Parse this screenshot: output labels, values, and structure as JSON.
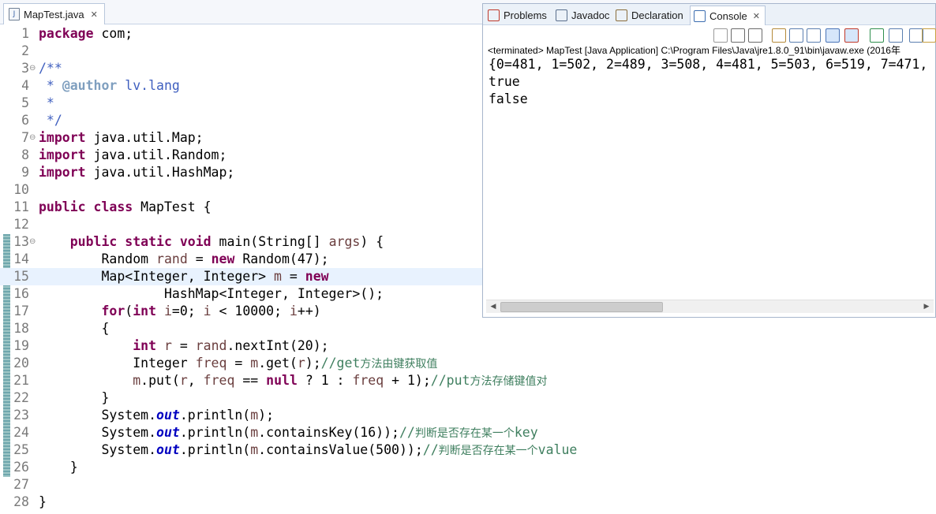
{
  "editor": {
    "tab": {
      "title": "MapTest.java",
      "close": "✕"
    },
    "lines": [
      {
        "n": "1",
        "segs": [
          {
            "t": "package",
            "c": "kw"
          },
          {
            "t": " com;"
          }
        ]
      },
      {
        "n": "2",
        "segs": []
      },
      {
        "n": "3",
        "fold": "⊖",
        "segs": [
          {
            "t": "/**",
            "c": "jd"
          }
        ]
      },
      {
        "n": "4",
        "segs": [
          {
            "t": " * ",
            "c": "jd"
          },
          {
            "t": "@author",
            "c": "tag"
          },
          {
            "t": " lv.lang",
            "c": "jd"
          }
        ]
      },
      {
        "n": "5",
        "segs": [
          {
            "t": " *",
            "c": "jd"
          }
        ]
      },
      {
        "n": "6",
        "segs": [
          {
            "t": " */",
            "c": "jd"
          }
        ]
      },
      {
        "n": "7",
        "fold": "⊖",
        "segs": [
          {
            "t": "import",
            "c": "kw"
          },
          {
            "t": " java.util.Map;"
          }
        ]
      },
      {
        "n": "8",
        "segs": [
          {
            "t": "import",
            "c": "kw"
          },
          {
            "t": " java.util.Random;"
          }
        ]
      },
      {
        "n": "9",
        "segs": [
          {
            "t": "import",
            "c": "kw"
          },
          {
            "t": " java.util.HashMap;"
          }
        ]
      },
      {
        "n": "10",
        "segs": []
      },
      {
        "n": "11",
        "segs": [
          {
            "t": "public",
            "c": "kw"
          },
          {
            "t": " "
          },
          {
            "t": "class",
            "c": "kw"
          },
          {
            "t": " MapTest {"
          }
        ]
      },
      {
        "n": "12",
        "segs": []
      },
      {
        "n": "13",
        "fold": "⊖",
        "segs": [
          {
            "t": "    "
          },
          {
            "t": "public",
            "c": "kw"
          },
          {
            "t": " "
          },
          {
            "t": "static",
            "c": "kw"
          },
          {
            "t": " "
          },
          {
            "t": "void",
            "c": "kw"
          },
          {
            "t": " main(String[] "
          },
          {
            "t": "args",
            "c": "var"
          },
          {
            "t": ") {"
          }
        ]
      },
      {
        "n": "14",
        "segs": [
          {
            "t": "        Random "
          },
          {
            "t": "rand",
            "c": "var"
          },
          {
            "t": " = "
          },
          {
            "t": "new",
            "c": "kw"
          },
          {
            "t": " Random(47);"
          }
        ]
      },
      {
        "n": "15",
        "current": true,
        "segs": [
          {
            "t": "        Map<Integer, Integer> "
          },
          {
            "t": "m",
            "c": "var"
          },
          {
            "t": " = "
          },
          {
            "t": "new",
            "c": "kw"
          }
        ]
      },
      {
        "n": "16",
        "segs": [
          {
            "t": "                HashMap<Integer, Integer>();"
          }
        ]
      },
      {
        "n": "17",
        "segs": [
          {
            "t": "        "
          },
          {
            "t": "for",
            "c": "kw"
          },
          {
            "t": "("
          },
          {
            "t": "int",
            "c": "kw"
          },
          {
            "t": " "
          },
          {
            "t": "i",
            "c": "var"
          },
          {
            "t": "=0; "
          },
          {
            "t": "i",
            "c": "var"
          },
          {
            "t": " < 10000; "
          },
          {
            "t": "i",
            "c": "var"
          },
          {
            "t": "++)"
          }
        ]
      },
      {
        "n": "18",
        "segs": [
          {
            "t": "        {"
          }
        ]
      },
      {
        "n": "19",
        "segs": [
          {
            "t": "            "
          },
          {
            "t": "int",
            "c": "kw"
          },
          {
            "t": " "
          },
          {
            "t": "r",
            "c": "var"
          },
          {
            "t": " = "
          },
          {
            "t": "rand",
            "c": "var"
          },
          {
            "t": ".nextInt(20);"
          }
        ]
      },
      {
        "n": "20",
        "segs": [
          {
            "t": "            Integer "
          },
          {
            "t": "freq",
            "c": "var"
          },
          {
            "t": " = "
          },
          {
            "t": "m",
            "c": "var"
          },
          {
            "t": ".get("
          },
          {
            "t": "r",
            "c": "var"
          },
          {
            "t": ");"
          },
          {
            "t": "//get",
            "c": "cm"
          },
          {
            "t": "方法由键获取值",
            "c": "cm cjk"
          }
        ]
      },
      {
        "n": "21",
        "segs": [
          {
            "t": "            "
          },
          {
            "t": "m",
            "c": "var"
          },
          {
            "t": ".put("
          },
          {
            "t": "r",
            "c": "var"
          },
          {
            "t": ", "
          },
          {
            "t": "freq",
            "c": "var"
          },
          {
            "t": " == "
          },
          {
            "t": "null",
            "c": "kw"
          },
          {
            "t": " ? 1 : "
          },
          {
            "t": "freq",
            "c": "var"
          },
          {
            "t": " + 1);"
          },
          {
            "t": "//put",
            "c": "cm"
          },
          {
            "t": "方法存储键值对",
            "c": "cm cjk"
          }
        ]
      },
      {
        "n": "22",
        "segs": [
          {
            "t": "        }"
          }
        ]
      },
      {
        "n": "23",
        "segs": [
          {
            "t": "        System."
          },
          {
            "t": "out",
            "c": "fld"
          },
          {
            "t": ".println("
          },
          {
            "t": "m",
            "c": "var"
          },
          {
            "t": ");"
          }
        ]
      },
      {
        "n": "24",
        "segs": [
          {
            "t": "        System."
          },
          {
            "t": "out",
            "c": "fld"
          },
          {
            "t": ".println("
          },
          {
            "t": "m",
            "c": "var"
          },
          {
            "t": ".containsKey(16));"
          },
          {
            "t": "//",
            "c": "cm"
          },
          {
            "t": "判断是否存在某一个",
            "c": "cm cjk"
          },
          {
            "t": "key",
            "c": "cm"
          }
        ]
      },
      {
        "n": "25",
        "segs": [
          {
            "t": "        System."
          },
          {
            "t": "out",
            "c": "fld"
          },
          {
            "t": ".println("
          },
          {
            "t": "m",
            "c": "var"
          },
          {
            "t": ".containsValue(500));"
          },
          {
            "t": "//",
            "c": "cm"
          },
          {
            "t": "判断是否存在某一个",
            "c": "cm cjk"
          },
          {
            "t": "value",
            "c": "cm"
          }
        ]
      },
      {
        "n": "26",
        "segs": [
          {
            "t": "    }"
          }
        ]
      },
      {
        "n": "27",
        "segs": []
      },
      {
        "n": "28",
        "segs": [
          {
            "t": "}"
          }
        ]
      }
    ]
  },
  "console": {
    "tabs": [
      {
        "label": "Problems",
        "icon": "problems-icon",
        "color": "#c0392b"
      },
      {
        "label": "Javadoc",
        "icon": "javadoc-icon",
        "color": "#5a6f8c"
      },
      {
        "label": "Declaration",
        "icon": "declaration-icon",
        "color": "#8a6d3b"
      },
      {
        "label": "Console",
        "icon": "console-icon",
        "color": "#3c6db0",
        "active": true,
        "close": "✕"
      }
    ],
    "toolbar": [
      "terminate-icon",
      "remove-launch-icon",
      "remove-all-icon",
      "clear-console-icon",
      "scroll-lock-icon",
      "word-wrap-icon",
      "show-on-stdout-icon",
      "show-on-stderr-icon",
      "pin-console-icon",
      "display-console-icon",
      "open-console-icon",
      "new-console-icon"
    ],
    "status": "<terminated> MapTest [Java Application] C:\\Program Files\\Java\\jre1.8.0_91\\bin\\javaw.exe (2016年",
    "output": [
      "{0=481, 1=502, 2=489, 3=508, 4=481, 5=503, 6=519, 7=471, ",
      "true",
      "false"
    ]
  },
  "colors": {
    "keyword": "#7f0055",
    "comment": "#3f7f5f",
    "javadoc": "#3f5fbf",
    "current_line": "#e8f2fe"
  }
}
